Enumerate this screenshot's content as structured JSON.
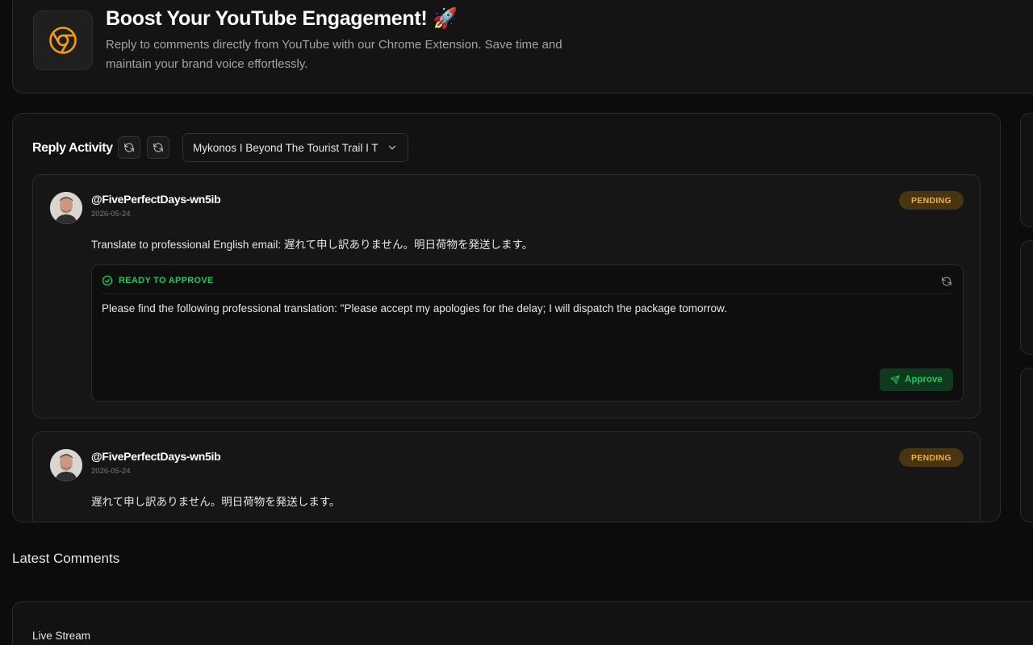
{
  "hero": {
    "title": "Boost Your YouTube Engagement! 🚀",
    "description": "Reply to comments directly from YouTube with our Chrome Extension. Save time and maintain your brand voice effortlessly.",
    "icon": "chrome-icon",
    "accent_color": "#f59e0b"
  },
  "activity": {
    "title": "Reply Activity",
    "selected_video": "Mykonos I Beyond The Tourist Trail I T",
    "comments": [
      {
        "handle": "@FivePerfectDays-wn5ib",
        "date": "2026-05-24",
        "status": "PENDING",
        "text": "Translate to professional English email: 遅れて申し訳ありません。明日荷物を発送します。",
        "draft": {
          "status": "READY TO APPROVE",
          "text": "Please find the following professional translation: \"Please accept my apologies for the delay; I will dispatch the package tomorrow.",
          "approve_label": "Approve"
        }
      },
      {
        "handle": "@FivePerfectDays-wn5ib",
        "date": "2026-05-24",
        "status": "PENDING",
        "text": "遅れて申し訳ありません。明日荷物を発送します。"
      }
    ]
  },
  "latest": {
    "title": "Latest Comments",
    "card_label": "Live Stream"
  },
  "colors": {
    "background": "#0c0c0c",
    "pending_badge": "#f0b040",
    "ready_green": "#22c55e"
  }
}
